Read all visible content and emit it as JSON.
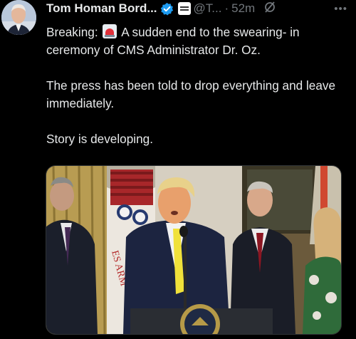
{
  "author": {
    "display_name": "Tom Homan Bord...",
    "handle": "@T...",
    "separator": "·",
    "time": "52m"
  },
  "tweet": {
    "line1_prefix": "Breaking:",
    "line1_rest": " A sudden end to the swearing- in ceremony of CMS Administrator Dr. Oz.",
    "paragraph2": "The press has been told to drop everything and leave immediately.",
    "paragraph3": "Story is developing."
  },
  "icons": {
    "verified": "verified-badge-icon",
    "affiliation": "affiliation-badge-icon",
    "grok": "grok-icon",
    "more": "more-icon",
    "siren": "siren-emoji-icon"
  },
  "colors": {
    "background": "#000000",
    "text": "#e7e9ea",
    "muted": "#71767b",
    "verified": "#1d9bf0"
  }
}
